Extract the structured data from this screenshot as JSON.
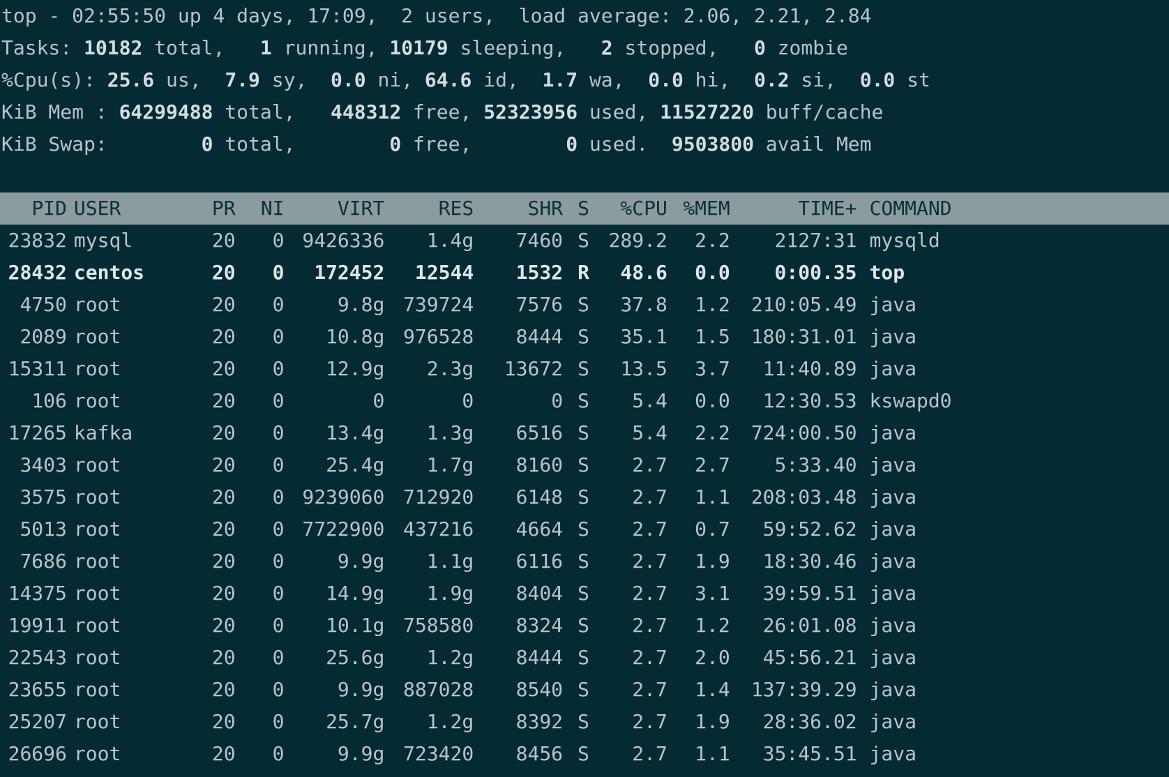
{
  "summary": {
    "uptime_line": "top - 02:55:50 up 4 days, 17:09,  2 users,  load average: 2.06, 2.21, 2.84",
    "tasks": {
      "label": "Tasks:",
      "total": "10182",
      "total_label": " total,",
      "running": "1",
      "running_label": " running,",
      "sleeping": "10179",
      "sleeping_label": " sleeping,",
      "stopped": "2",
      "stopped_label": " stopped,",
      "zombie": "0",
      "zombie_label": " zombie"
    },
    "cpu": {
      "label": "%Cpu(s):",
      "us": "25.6",
      "us_label": " us,",
      "sy": "7.9",
      "sy_label": " sy,",
      "ni": "0.0",
      "ni_label": " ni,",
      "id": "64.6",
      "id_label": " id,",
      "wa": "1.7",
      "wa_label": " wa,",
      "hi": "0.0",
      "hi_label": " hi,",
      "si": "0.2",
      "si_label": " si,",
      "st": "0.0",
      "st_label": " st"
    },
    "mem": {
      "label": "KiB Mem :",
      "total": "64299488",
      "total_label": " total,",
      "free": "448312",
      "free_label": " free,",
      "used": "52323956",
      "used_label": " used,",
      "buff": "11527220",
      "buff_label": " buff/cache"
    },
    "swap": {
      "label": "KiB Swap:",
      "total": "0",
      "total_label": " total,",
      "free": "0",
      "free_label": " free,",
      "used": "0",
      "used_label": " used.",
      "avail": "9503800",
      "avail_label": " avail Mem"
    }
  },
  "columns": {
    "pid": "PID",
    "user": "USER",
    "pr": "PR",
    "ni": "NI",
    "virt": "VIRT",
    "res": "RES",
    "shr": "SHR",
    "s": "S",
    "cpu": "%CPU",
    "mem": "%MEM",
    "time": "TIME+",
    "command": "COMMAND"
  },
  "processes": [
    {
      "pid": "23832",
      "user": "mysql",
      "pr": "20",
      "ni": "0",
      "virt": "9426336",
      "res": "1.4g",
      "shr": "7460",
      "s": "S",
      "cpu": "289.2",
      "mem": "2.2",
      "time": "2127:31",
      "command": "mysqld"
    },
    {
      "pid": "28432",
      "user": "centos",
      "pr": "20",
      "ni": "0",
      "virt": "172452",
      "res": "12544",
      "shr": "1532",
      "s": "R",
      "cpu": "48.6",
      "mem": "0.0",
      "time": "0:00.35",
      "command": "top"
    },
    {
      "pid": "4750",
      "user": "root",
      "pr": "20",
      "ni": "0",
      "virt": "9.8g",
      "res": "739724",
      "shr": "7576",
      "s": "S",
      "cpu": "37.8",
      "mem": "1.2",
      "time": "210:05.49",
      "command": "java"
    },
    {
      "pid": "2089",
      "user": "root",
      "pr": "20",
      "ni": "0",
      "virt": "10.8g",
      "res": "976528",
      "shr": "8444",
      "s": "S",
      "cpu": "35.1",
      "mem": "1.5",
      "time": "180:31.01",
      "command": "java"
    },
    {
      "pid": "15311",
      "user": "root",
      "pr": "20",
      "ni": "0",
      "virt": "12.9g",
      "res": "2.3g",
      "shr": "13672",
      "s": "S",
      "cpu": "13.5",
      "mem": "3.7",
      "time": "11:40.89",
      "command": "java"
    },
    {
      "pid": "106",
      "user": "root",
      "pr": "20",
      "ni": "0",
      "virt": "0",
      "res": "0",
      "shr": "0",
      "s": "S",
      "cpu": "5.4",
      "mem": "0.0",
      "time": "12:30.53",
      "command": "kswapd0"
    },
    {
      "pid": "17265",
      "user": "kafka",
      "pr": "20",
      "ni": "0",
      "virt": "13.4g",
      "res": "1.3g",
      "shr": "6516",
      "s": "S",
      "cpu": "5.4",
      "mem": "2.2",
      "time": "724:00.50",
      "command": "java"
    },
    {
      "pid": "3403",
      "user": "root",
      "pr": "20",
      "ni": "0",
      "virt": "25.4g",
      "res": "1.7g",
      "shr": "8160",
      "s": "S",
      "cpu": "2.7",
      "mem": "2.7",
      "time": "5:33.40",
      "command": "java"
    },
    {
      "pid": "3575",
      "user": "root",
      "pr": "20",
      "ni": "0",
      "virt": "9239060",
      "res": "712920",
      "shr": "6148",
      "s": "S",
      "cpu": "2.7",
      "mem": "1.1",
      "time": "208:03.48",
      "command": "java"
    },
    {
      "pid": "5013",
      "user": "root",
      "pr": "20",
      "ni": "0",
      "virt": "7722900",
      "res": "437216",
      "shr": "4664",
      "s": "S",
      "cpu": "2.7",
      "mem": "0.7",
      "time": "59:52.62",
      "command": "java"
    },
    {
      "pid": "7686",
      "user": "root",
      "pr": "20",
      "ni": "0",
      "virt": "9.9g",
      "res": "1.1g",
      "shr": "6116",
      "s": "S",
      "cpu": "2.7",
      "mem": "1.9",
      "time": "18:30.46",
      "command": "java"
    },
    {
      "pid": "14375",
      "user": "root",
      "pr": "20",
      "ni": "0",
      "virt": "14.9g",
      "res": "1.9g",
      "shr": "8404",
      "s": "S",
      "cpu": "2.7",
      "mem": "3.1",
      "time": "39:59.51",
      "command": "java"
    },
    {
      "pid": "19911",
      "user": "root",
      "pr": "20",
      "ni": "0",
      "virt": "10.1g",
      "res": "758580",
      "shr": "8324",
      "s": "S",
      "cpu": "2.7",
      "mem": "1.2",
      "time": "26:01.08",
      "command": "java"
    },
    {
      "pid": "22543",
      "user": "root",
      "pr": "20",
      "ni": "0",
      "virt": "25.6g",
      "res": "1.2g",
      "shr": "8444",
      "s": "S",
      "cpu": "2.7",
      "mem": "2.0",
      "time": "45:56.21",
      "command": "java"
    },
    {
      "pid": "23655",
      "user": "root",
      "pr": "20",
      "ni": "0",
      "virt": "9.9g",
      "res": "887028",
      "shr": "8540",
      "s": "S",
      "cpu": "2.7",
      "mem": "1.4",
      "time": "137:39.29",
      "command": "java"
    },
    {
      "pid": "25207",
      "user": "root",
      "pr": "20",
      "ni": "0",
      "virt": "25.7g",
      "res": "1.2g",
      "shr": "8392",
      "s": "S",
      "cpu": "2.7",
      "mem": "1.9",
      "time": "28:36.02",
      "command": "java"
    },
    {
      "pid": "26696",
      "user": "root",
      "pr": "20",
      "ni": "0",
      "virt": "9.9g",
      "res": "723420",
      "shr": "8456",
      "s": "S",
      "cpu": "2.7",
      "mem": "1.1",
      "time": "35:45.51",
      "command": "java"
    }
  ]
}
